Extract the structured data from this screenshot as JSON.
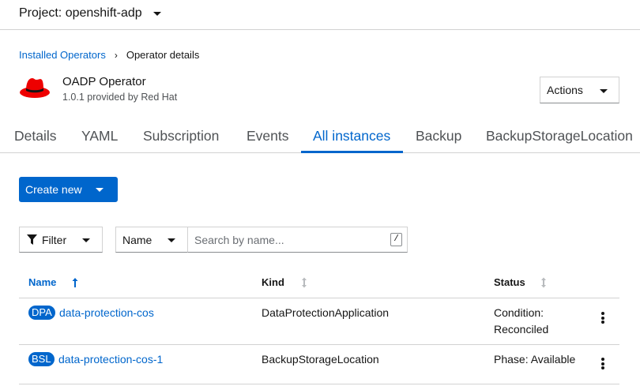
{
  "project": {
    "label": "Project: openshift-adp"
  },
  "breadcrumb": {
    "parent": "Installed Operators",
    "current": "Operator details"
  },
  "operator": {
    "name": "OADP Operator",
    "provider": "1.0.1 provided by Red Hat"
  },
  "actions": {
    "label": "Actions"
  },
  "tabs": [
    "Details",
    "YAML",
    "Subscription",
    "Events",
    "All instances",
    "Backup",
    "BackupStorageLocation"
  ],
  "active_tab": "All instances",
  "toolbar": {
    "create_label": "Create new",
    "filter_label": "Filter",
    "name_select": "Name",
    "search_placeholder": "Search by name...",
    "shortcut_key": "/"
  },
  "table": {
    "headers": {
      "name": "Name",
      "kind": "Kind",
      "status": "Status"
    },
    "rows": [
      {
        "badge": "DPA",
        "name": "data-protection-cos",
        "kind": "DataProtectionApplication",
        "status_line1": "Condition:",
        "status_line2": "Reconciled"
      },
      {
        "badge": "BSL",
        "name": "data-protection-cos-1",
        "kind": "BackupStorageLocation",
        "status_line1": "Phase: Available",
        "status_line2": ""
      }
    ]
  },
  "colors": {
    "accent": "#0066cc",
    "brand_red": "#ee0000",
    "text": "#151515",
    "border": "#d2d2d2"
  },
  "icons": [
    "caret-down-icon",
    "chevron-right-icon",
    "redhat-hat-icon",
    "filter-funnel-icon",
    "sort-ascending-icon",
    "sort-neutral-icon",
    "kebab-icon"
  ]
}
